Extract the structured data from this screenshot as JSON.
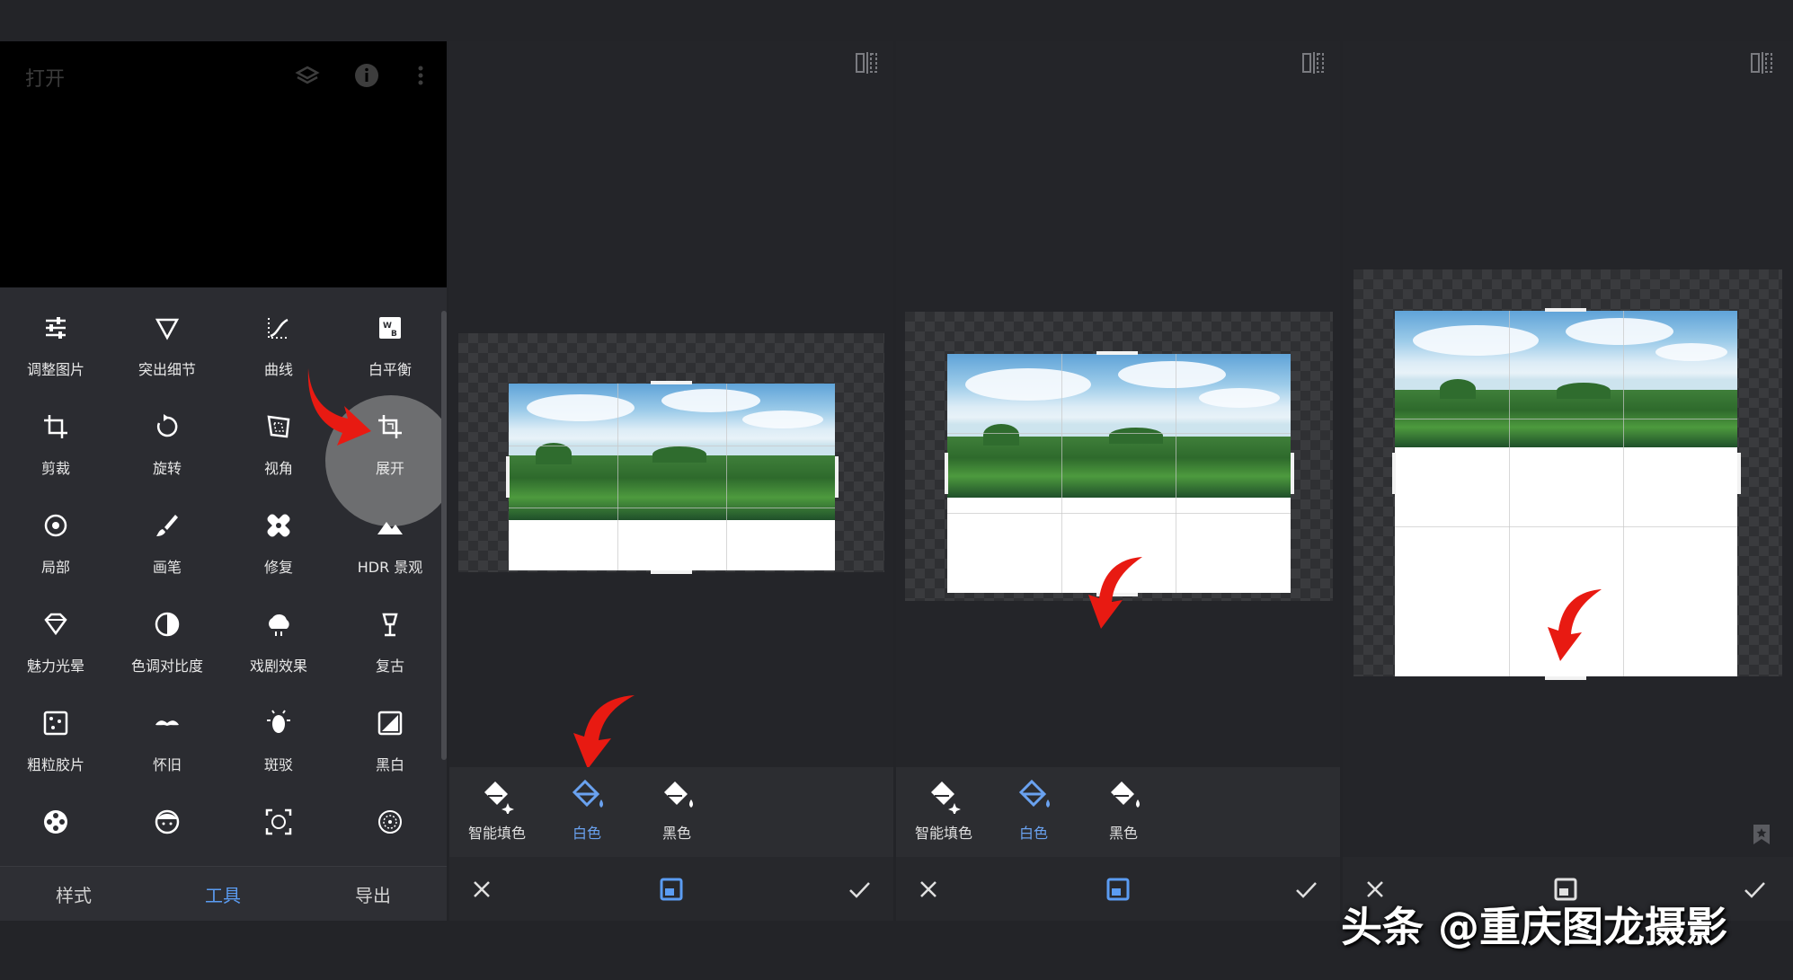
{
  "panel1": {
    "title": "打开",
    "tools": [
      {
        "label": "调整图片",
        "icon": "sliders-icon"
      },
      {
        "label": "突出细节",
        "icon": "triangle-icon"
      },
      {
        "label": "曲线",
        "icon": "curves-icon"
      },
      {
        "label": "白平衡",
        "icon": "white-balance-icon"
      },
      {
        "label": "剪裁",
        "icon": "crop-icon"
      },
      {
        "label": "旋转",
        "icon": "rotate-icon"
      },
      {
        "label": "视角",
        "icon": "perspective-icon"
      },
      {
        "label": "展开",
        "icon": "expand-icon"
      },
      {
        "label": "局部",
        "icon": "selective-icon"
      },
      {
        "label": "画笔",
        "icon": "brush-icon"
      },
      {
        "label": "修复",
        "icon": "healing-icon"
      },
      {
        "label": "HDR 景观",
        "icon": "hdr-icon"
      },
      {
        "label": "魅力光晕",
        "icon": "glamour-glow-icon"
      },
      {
        "label": "色调对比度",
        "icon": "tonal-contrast-icon"
      },
      {
        "label": "戏剧效果",
        "icon": "drama-icon"
      },
      {
        "label": "复古",
        "icon": "vintage-icon"
      },
      {
        "label": "粗粒胶片",
        "icon": "grainy-film-icon"
      },
      {
        "label": "怀旧",
        "icon": "retrolux-icon"
      },
      {
        "label": "斑驳",
        "icon": "grunge-icon"
      },
      {
        "label": "黑白",
        "icon": "black-white-icon"
      },
      {
        "label": "",
        "icon": "film-reel-icon"
      },
      {
        "label": "",
        "icon": "face-icon"
      },
      {
        "label": "",
        "icon": "face-detect-icon"
      },
      {
        "label": "",
        "icon": "double-exposure-icon"
      }
    ],
    "nav": {
      "styles": "样式",
      "tools": "工具",
      "export": "导出"
    }
  },
  "fill_options": {
    "smart": "智能填色",
    "white": "白色",
    "black": "黑色"
  },
  "colors": {
    "accent": "#5b9cf2",
    "arrow": "#e81a12"
  },
  "watermark": "头条 @重庆图龙摄影"
}
